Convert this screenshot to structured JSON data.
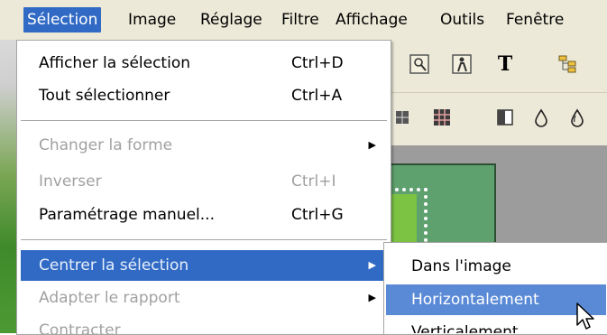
{
  "menubar": {
    "items": [
      {
        "label": "Sélection",
        "active": true
      },
      {
        "label": "Image"
      },
      {
        "label": "Réglage"
      },
      {
        "label": "Filtre"
      },
      {
        "label": "Affichage"
      },
      {
        "label": "Outils"
      },
      {
        "label": "Fenêtre"
      }
    ]
  },
  "toolbar": {
    "icons": [
      "find-icon",
      "person-icon",
      "text-tool-icon",
      "layers-icon",
      "grid-icon",
      "grid-dark-icon",
      "pattern-icon",
      "drop-icon",
      "drop-outline-icon"
    ],
    "text_tool_glyph": "T"
  },
  "menu": {
    "items": [
      {
        "label": "Afficher la sélection",
        "shortcut": "Ctrl+D",
        "enabled": true
      },
      {
        "label": "Tout sélectionner",
        "shortcut": "Ctrl+A",
        "enabled": true
      },
      {
        "label": "Changer la forme",
        "shortcut": "",
        "enabled": false,
        "submenu": true
      },
      {
        "label": "Inverser",
        "shortcut": "Ctrl+I",
        "enabled": false
      },
      {
        "label": "Paramétrage manuel...",
        "shortcut": "Ctrl+G",
        "enabled": true
      },
      {
        "label": "Centrer la sélection",
        "shortcut": "",
        "enabled": true,
        "submenu": true,
        "highlighted": true
      },
      {
        "label": "Adapter le rapport",
        "shortcut": "",
        "enabled": false,
        "submenu": true
      },
      {
        "label": "Contracter",
        "shortcut": "",
        "enabled": false
      }
    ]
  },
  "submenu": {
    "items": [
      {
        "label": "Dans l'image"
      },
      {
        "label": "Horizontalement",
        "highlighted": true
      },
      {
        "label": "Verticalement"
      }
    ]
  },
  "colors": {
    "highlight": "#316ac5",
    "sub_highlight": "#5a8ad6",
    "menu_bg": "#ffffff",
    "bar_bg": "#ece9d8",
    "disabled_text": "#a1a1a1"
  }
}
